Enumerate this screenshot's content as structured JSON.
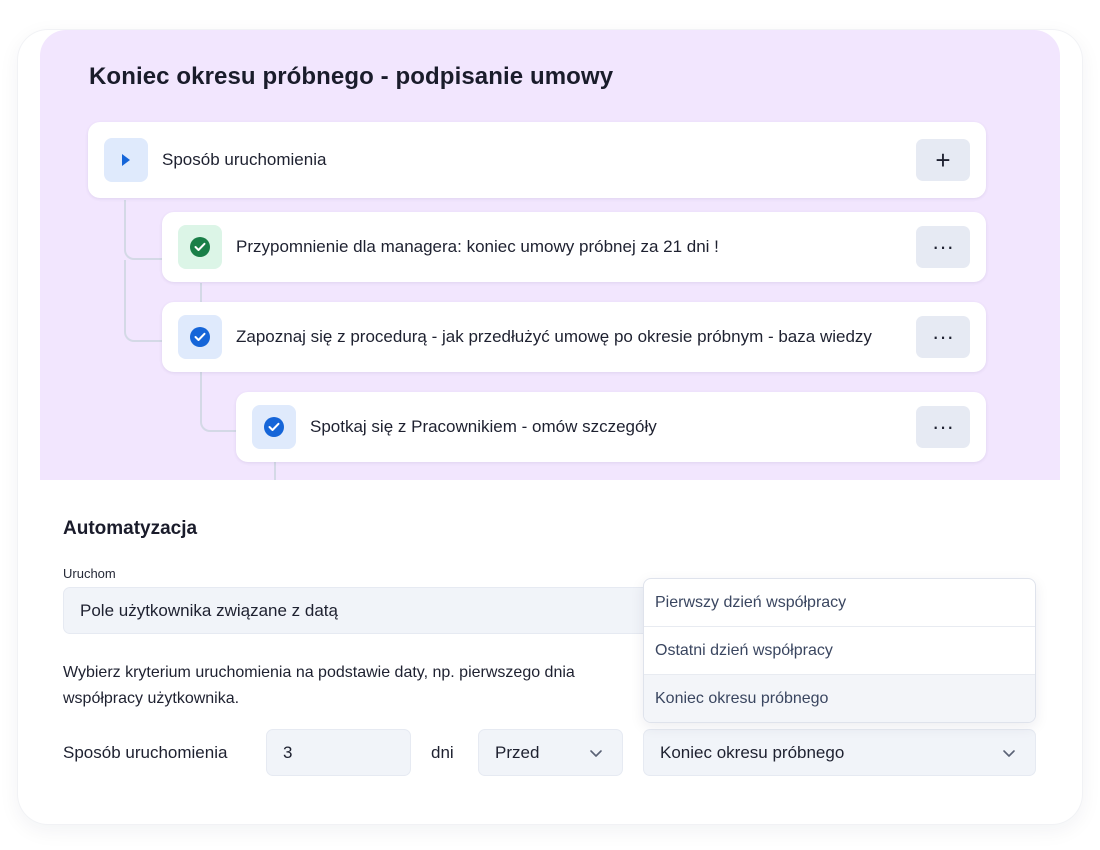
{
  "workflow": {
    "title": "Koniec okresu próbnego - podpisanie umowy",
    "trigger_step": {
      "label": "Sposób uruchomienia",
      "add_button": "+"
    },
    "steps": [
      {
        "label": "Przypomnienie dla managera: koniec umowy próbnej za 21 dni !",
        "status": "completed",
        "color": "#1a7f48"
      },
      {
        "label": "Zapoznaj się z procedurą - jak przedłużyć umowę po okresie próbnym - baza wiedzy",
        "status": "checked",
        "color": "#1565d8"
      },
      {
        "label": "Spotkaj się z Pracownikiem - omów szczegóły",
        "status": "checked",
        "color": "#1565d8"
      }
    ],
    "more_button": "···"
  },
  "automation": {
    "title": "Automatyzacja",
    "trigger_label": "Uruchom",
    "trigger_value": "Pole użytkownika związane z datą",
    "helper_text": "Wybierz kryterium uruchomienia na podstawie daty, np. pierwszego dnia współpracy użytkownika.",
    "row": {
      "label": "Sposób uruchomienia",
      "days_value": "3",
      "unit": "dni",
      "timing_value": "Przed",
      "date_field_value": "Koniec okresu próbnego"
    },
    "dropdown_options": [
      "Pierwszy dzień współpracy",
      "Ostatni dzień współpracy",
      "Koniec okresu próbnego"
    ],
    "selected_option_index": 2
  },
  "colors": {
    "workflow_bg": "#f2e6fe",
    "accent_blue": "#1565d8",
    "accent_green": "#1a7f48"
  }
}
